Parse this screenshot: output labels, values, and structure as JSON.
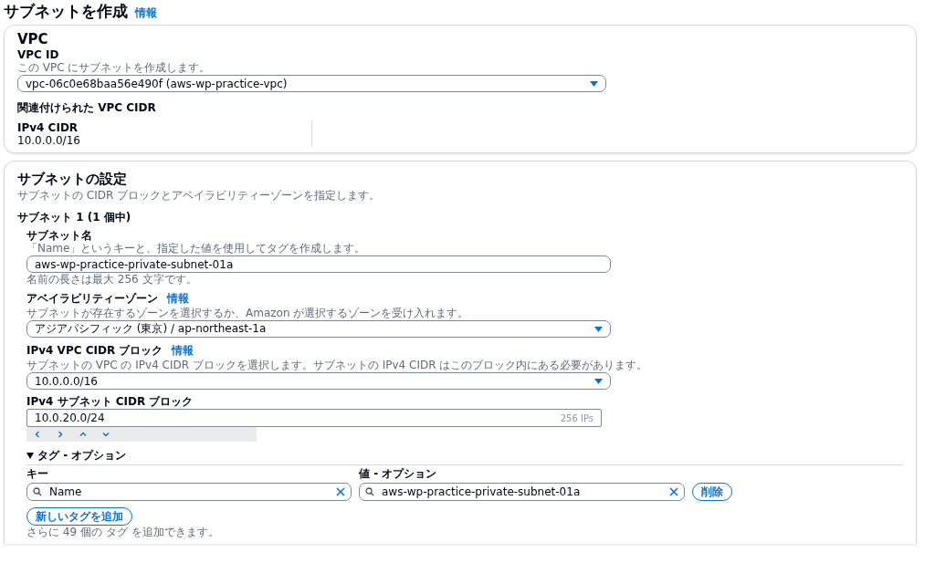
{
  "page": {
    "title": "サブネットを作成",
    "info_link": "情報"
  },
  "vpc_panel": {
    "heading": "VPC",
    "vpc_id": {
      "label": "VPC ID",
      "description": "この VPC にサブネットを作成します。",
      "value": "vpc-06c0e68baa56e490f (aws-wp-practice-vpc)"
    },
    "cidr_heading": "関連付けられた VPC CIDR",
    "cidr_label": "IPv4 CIDR",
    "cidr_value": "10.0.0.0/16"
  },
  "subnet_panel": {
    "heading": "サブネットの設定",
    "description": "サブネットの CIDR ブロックとアベイラビリティーゾーンを指定します。",
    "subnet_heading": "サブネット 1 (1 個中)",
    "fields": [
      {
        "kind": "text",
        "label": "サブネット名",
        "description": "「Name」というキーと、指定した値を使用してタグを作成します。",
        "value": "aws-wp-practice-private-subnet-01a",
        "constraint": "名前の長さは最大 256 文字です。"
      },
      {
        "kind": "select",
        "label": "アベイラビリティーゾーン",
        "info_link": "情報",
        "description": "サブネットが存在するゾーンを選択するか、Amazon が選択するゾーンを受け入れます。",
        "value": "アジアパシフィック (東京) / ap-northeast-1a"
      },
      {
        "kind": "select",
        "label": "IPv4 VPC CIDR ブロック",
        "info_link": "情報",
        "description": "サブネットの VPC の IPv4 CIDR ブロックを選択します。サブネットの IPv4 CIDR はこのブロック内にある必要があります。",
        "value": "10.0.0.0/16"
      },
      {
        "kind": "cidr",
        "label": "IPv4 サブネット CIDR ブロック",
        "value": "10.0.20.0/24",
        "suffix": "256 IPs"
      }
    ],
    "tags": {
      "heading": "タグ - オプション",
      "expanded": true,
      "key_label": "キー",
      "value_label": "値 - オプション",
      "rows": [
        {
          "key": "Name",
          "value": "aws-wp-practice-private-subnet-01a",
          "remove": "削除"
        }
      ],
      "add_button": "新しいタグを追加",
      "limit_note": "さらに 49 個の タグ を追加できます。"
    }
  }
}
